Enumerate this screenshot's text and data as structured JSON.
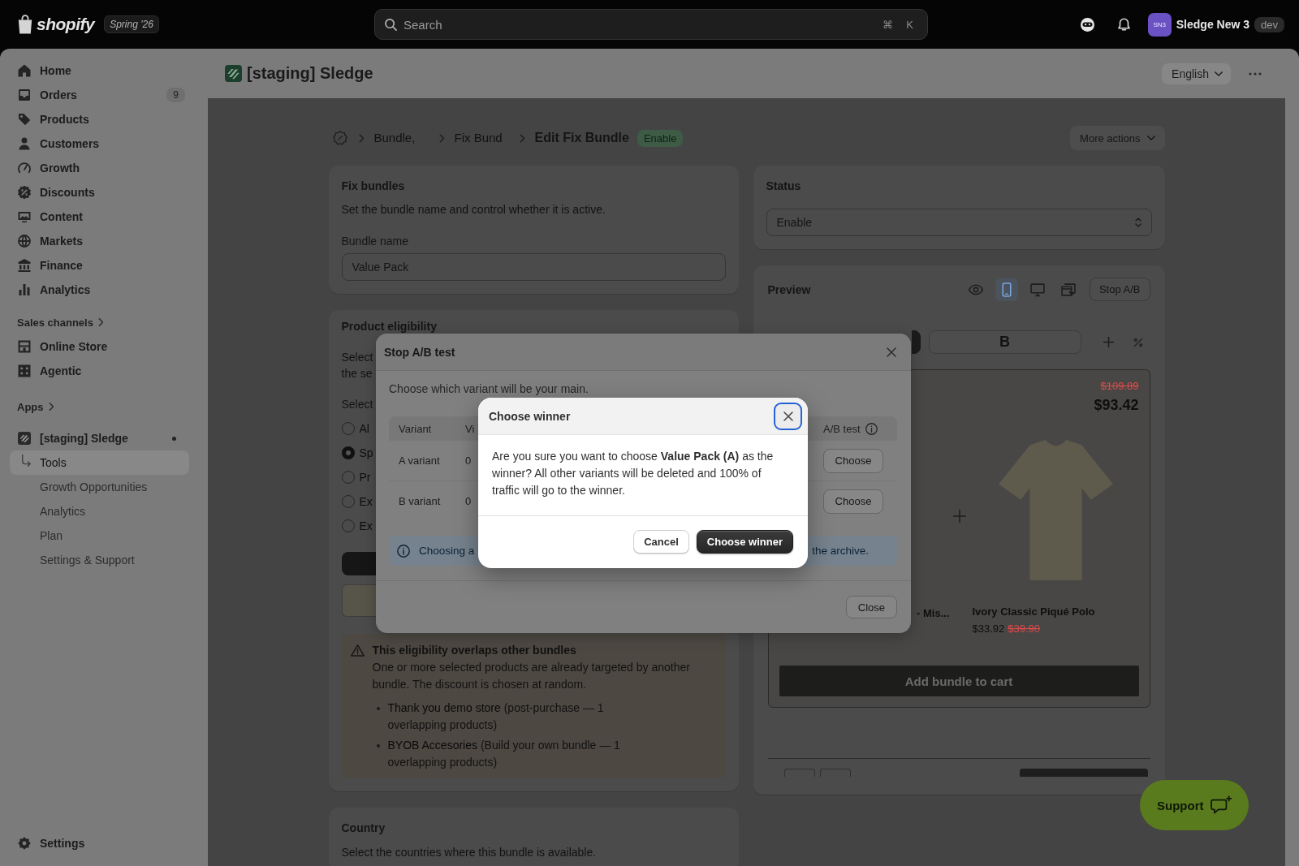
{
  "top_bar": {
    "logo": "shopify",
    "edition": "Spring '26",
    "search": {
      "placeholder": "Search",
      "shortcut": [
        "⌘",
        "K"
      ]
    },
    "account": {
      "initials": "SN3",
      "name": "Sledge New 3",
      "badge": "dev"
    }
  },
  "sidebar": {
    "items": [
      {
        "label": "Home",
        "selected": false
      },
      {
        "label": "Orders",
        "badge": "9",
        "selected": false
      },
      {
        "label": "Products",
        "selected": false
      },
      {
        "label": "Customers",
        "selected": false
      },
      {
        "label": "Growth",
        "selected": false
      },
      {
        "label": "Discounts",
        "selected": false
      },
      {
        "label": "Content",
        "selected": false
      },
      {
        "label": "Markets",
        "selected": false
      },
      {
        "label": "Finance",
        "selected": false
      },
      {
        "label": "Analytics",
        "selected": false
      }
    ],
    "sales_channels": {
      "heading": "Sales channels",
      "items": [
        {
          "label": "Online Store",
          "selected": false
        },
        {
          "label": "Agentic",
          "selected": false
        }
      ]
    },
    "apps": {
      "heading": "Apps",
      "items": [
        {
          "label": "[staging] Sledge",
          "selected": false,
          "expanded": true,
          "children": [
            {
              "label": "Tools",
              "selected": true
            },
            {
              "label": "Growth Opportunities",
              "selected": false
            },
            {
              "label": "Analytics",
              "selected": false
            },
            {
              "label": "Plan",
              "selected": false
            },
            {
              "label": "Settings & Support",
              "selected": false
            }
          ]
        }
      ]
    },
    "settings": {
      "label": "Settings",
      "selected": false
    }
  },
  "app_header": {
    "title": "[staging] Sledge",
    "language": "English"
  },
  "page": {
    "breadcrumbs": [
      "Bundle,",
      "Fix Bund"
    ],
    "title": "Edit Fix Bundle",
    "status_badge": "Enable",
    "more_actions": "More actions",
    "fix_bundles": {
      "title": "Fix bundles",
      "description": "Set the bundle name and control whether it is active.",
      "field_label": "Bundle name",
      "field_value": "Value Pack"
    },
    "product_eligibility": {
      "title": "Product eligibility",
      "description_lines": [
        "Select",
        "the se"
      ],
      "options_label": "Select",
      "options": [
        {
          "label": "Al",
          "selected": false
        },
        {
          "label": "Sp",
          "selected": true
        },
        {
          "label": "Pr",
          "selected": false
        },
        {
          "label": "Ex",
          "selected": false
        },
        {
          "label": "Ex",
          "selected": false
        }
      ],
      "warning": {
        "title": "This eligibility overlaps other bundles",
        "text": "One or more selected products are already targeted by another bundle. The discount is chosen at random.",
        "items": [
          {
            "name": "Thank you demo store",
            "detail": "(post-purchase — 1 overlapping products)"
          },
          {
            "name": "BYOB Accesories",
            "detail": "(Build your own bundle — 1 overlapping products)"
          }
        ]
      }
    },
    "country": {
      "title": "Country",
      "description": "Select the countries where this bundle is available."
    },
    "status": {
      "title": "Status",
      "value": "Enable"
    },
    "preview": {
      "title": "Preview",
      "view_modes": [
        {
          "selected": false
        },
        {
          "selected": true
        },
        {
          "selected": false
        },
        {
          "selected": false
        }
      ],
      "stop_button": "Stop A/B",
      "variant_tabs": [
        {
          "selected": true
        },
        {
          "label": "B",
          "selected": false
        }
      ],
      "compare_price": "$109.89",
      "price": "$93.42",
      "products": [
        {
          "title": "- Mis..."
        },
        {
          "title": "Ivory Classic Piqué Polo",
          "price": "$33.92",
          "compare_price": "$39.90"
        }
      ],
      "cart_button": "Add bundle to cart"
    }
  },
  "support_button": {
    "label": "Support"
  },
  "stop_ab_dialog": {
    "title": "Stop A/B test",
    "description": "Choose which variant will be your main.",
    "columns": [
      "Variant",
      "Vi",
      "A/B test"
    ],
    "rows": [
      {
        "variant": "A variant",
        "column_2": "0",
        "action": "Choose"
      },
      {
        "variant": "B variant",
        "column_2": "0",
        "action": "Choose"
      }
    ],
    "notice": {
      "start": "Choosing a",
      "end": "the archive."
    },
    "close_button": "Close"
  },
  "winner_dialog": {
    "title": "Choose winner",
    "close_focused": true,
    "message": "Are you sure you want to choose **Value Pack (A)** as the winner? All other variants will be deleted and 100% of traffic will go to the winner.",
    "buttons": [
      {
        "label": "Cancel",
        "kind": "secondary"
      },
      {
        "label": "Choose winner",
        "kind": "primary"
      }
    ]
  }
}
